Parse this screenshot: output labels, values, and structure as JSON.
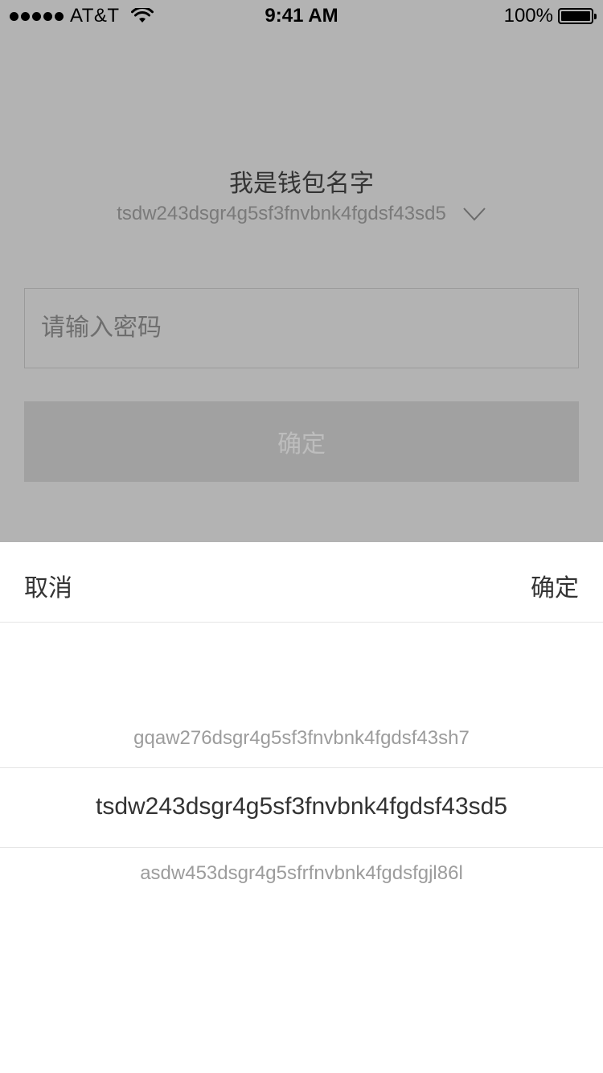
{
  "status_bar": {
    "carrier": "AT&T",
    "time": "9:41 AM",
    "battery": "100%"
  },
  "wallet": {
    "name": "我是钱包名字",
    "address": "tsdw243dsgr4g5sf3fnvbnk4fgdsf43sd5"
  },
  "password": {
    "placeholder": "请输入密码",
    "value": ""
  },
  "confirm_button_label": "确定",
  "picker": {
    "cancel_label": "取消",
    "confirm_label": "确定",
    "options": [
      "gqaw276dsgr4g5sf3fnvbnk4fgdsf43sh7",
      "tsdw243dsgr4g5sf3fnvbnk4fgdsf43sd5",
      "asdw453dsgr4g5sfrfnvbnk4fgdsfgjl86l"
    ],
    "selected_index": 1
  }
}
